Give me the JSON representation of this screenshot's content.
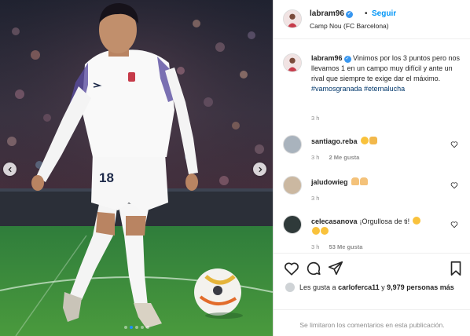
{
  "post": {
    "username": "labram96",
    "follow_label": "Seguir",
    "separator": "•",
    "location": "Camp Nou (FC Barcelona)",
    "verified_glyph": "✓"
  },
  "caption": {
    "username": "labram96",
    "text": "Vinimos por los 3 puntos pero nos llevamos 1 en un campo muy difícil y ante un rival que siempre te exige dar el máximo.",
    "hashtags": "#vamosgranada #eternalucha",
    "time": "3 h"
  },
  "comments": [
    {
      "username": "santiago.reba",
      "text": "",
      "emojis": [
        "star-struck",
        "clapping-hands"
      ],
      "time": "3 h",
      "likes": "2 Me gusta",
      "reply": ""
    },
    {
      "username": "jaludowieg",
      "text": "",
      "emojis": [
        "flexed-biceps",
        "flexed-biceps"
      ],
      "time": "3 h",
      "likes": "",
      "reply": ""
    },
    {
      "username": "celecasanova",
      "text": "¡Orgullosa de ti!",
      "emojis": [
        "star-struck",
        "star-struck",
        "star-struck"
      ],
      "time": "3 h",
      "likes": "53 Me gusta",
      "reply": ""
    }
  ],
  "likes": {
    "prefix": "Les gusta a",
    "user": "carloferca11",
    "middle": "y",
    "count": "9,979",
    "suffix": "personas más"
  },
  "footer": {
    "disabled_text": "Se limitaron los comentarios en esta publicación."
  },
  "carousel": {
    "total": 5,
    "active_index": 1,
    "active_color": "#1e90ff"
  },
  "icons": {
    "like": "heart-icon",
    "comment": "comment-icon",
    "share": "share-icon",
    "save": "bookmark-icon",
    "prev": "chevron-left-icon",
    "next": "chevron-right-icon"
  },
  "jersey": {
    "number": "18"
  }
}
